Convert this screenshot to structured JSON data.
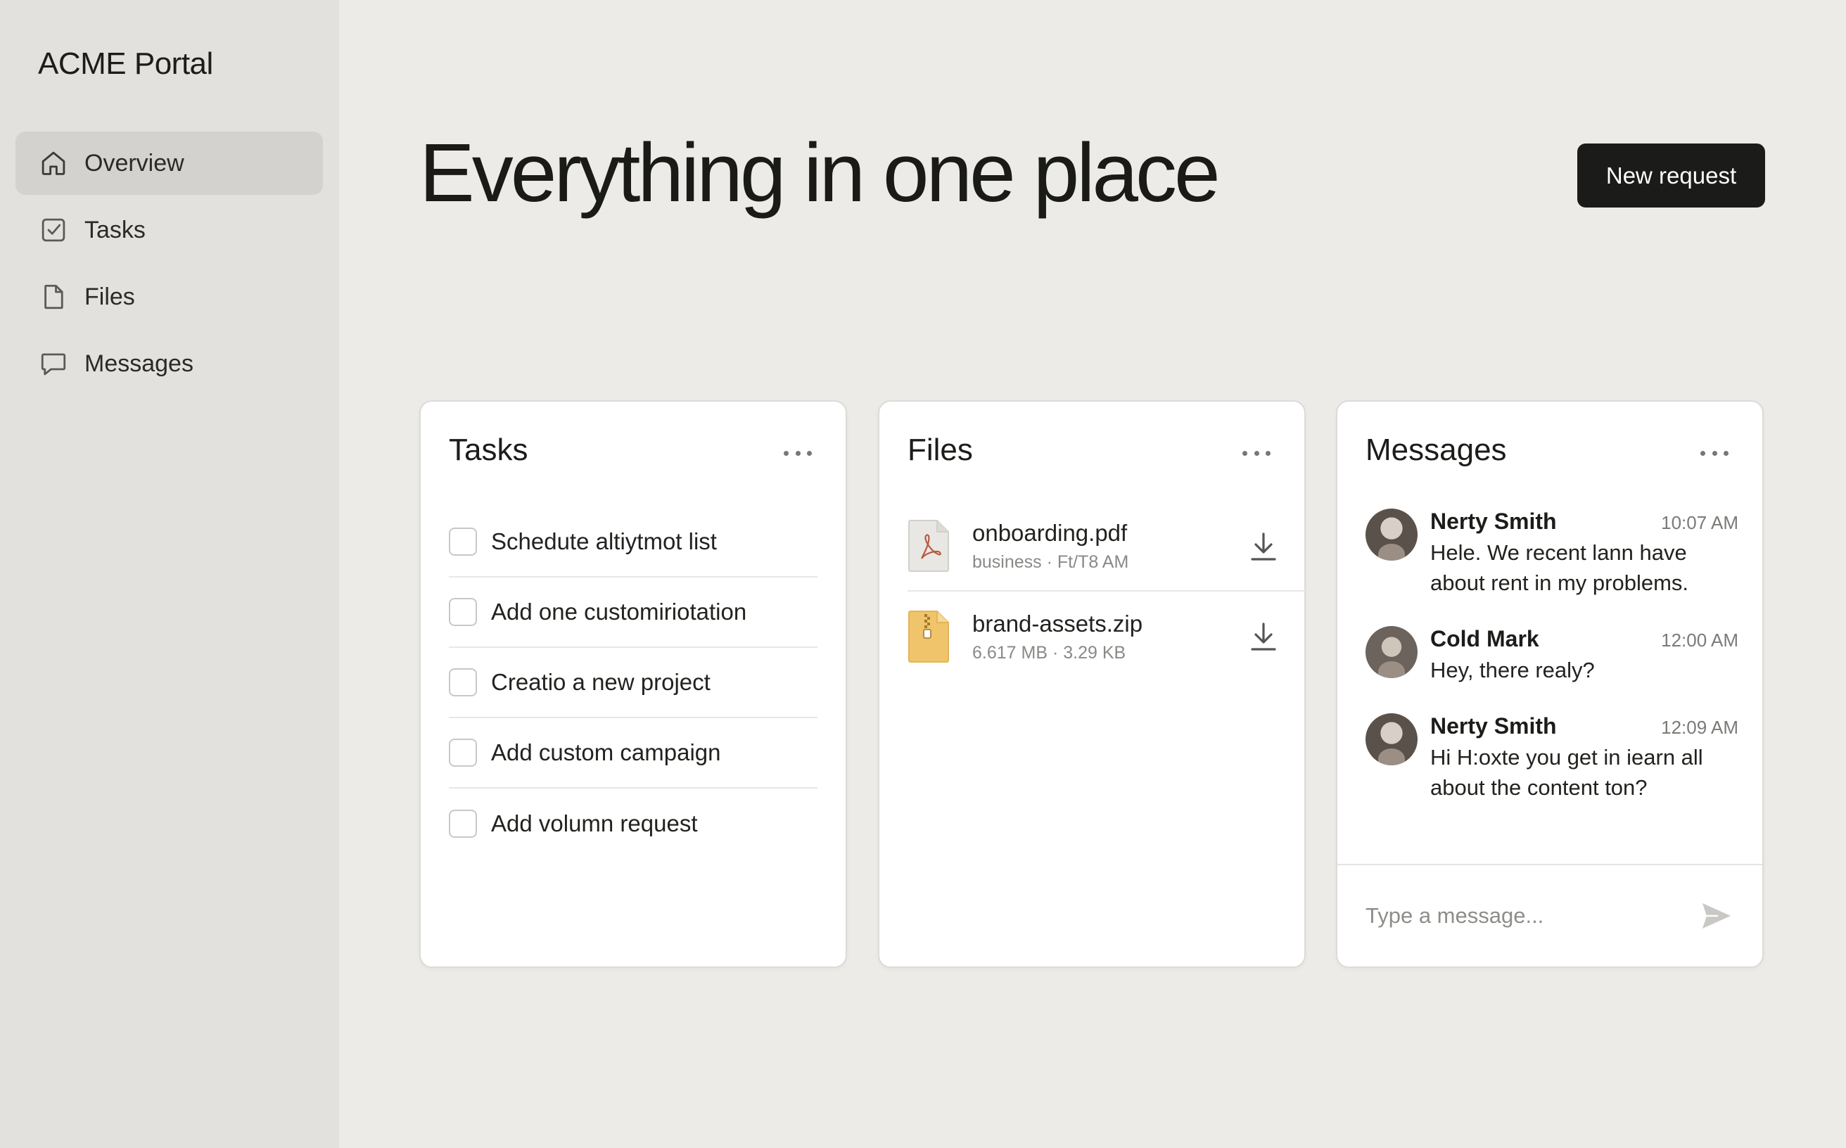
{
  "app": {
    "brand": "ACME Portal"
  },
  "sidebar": {
    "items": [
      {
        "label": "Overview",
        "icon": "home-icon",
        "active": true
      },
      {
        "label": "Tasks",
        "icon": "checkbox-icon",
        "active": false
      },
      {
        "label": "Files",
        "icon": "file-icon",
        "active": false
      },
      {
        "label": "Messages",
        "icon": "chat-icon",
        "active": false
      }
    ]
  },
  "header": {
    "title": "Everything in one place",
    "new_request_label": "New request"
  },
  "tasks": {
    "title": "Tasks",
    "items": [
      {
        "label": "Schedute altiytmot list",
        "checked": false
      },
      {
        "label": "Add one customiriotation",
        "checked": false
      },
      {
        "label": "Creatio a new project",
        "checked": false
      },
      {
        "label": "Add custom campaign",
        "checked": false
      },
      {
        "label": "Add volumn request",
        "checked": false
      }
    ]
  },
  "files": {
    "title": "Files",
    "items": [
      {
        "name": "onboarding.pdf",
        "meta": "business · Ft/T8 AM",
        "icon": "pdf-icon",
        "color": "#e9e7e3"
      },
      {
        "name": "brand-assets.zip",
        "meta": "6.617 MB · 3.29 KB",
        "icon": "zip-icon",
        "color": "#f0c46a"
      }
    ]
  },
  "messages": {
    "title": "Messages",
    "items": [
      {
        "author": "Nerty Smith",
        "time": "10:07 AM",
        "text": "Hele. We recent lann have about rent in my problems."
      },
      {
        "author": "Cold Mark",
        "time": "12:00 AM",
        "text": "Hey, there realy?"
      },
      {
        "author": "Nerty Smith",
        "time": "12:09 AM",
        "text": "Hi H:oxte you get in iearn all about the content ton?"
      }
    ],
    "composer_placeholder": "Type a message..."
  }
}
